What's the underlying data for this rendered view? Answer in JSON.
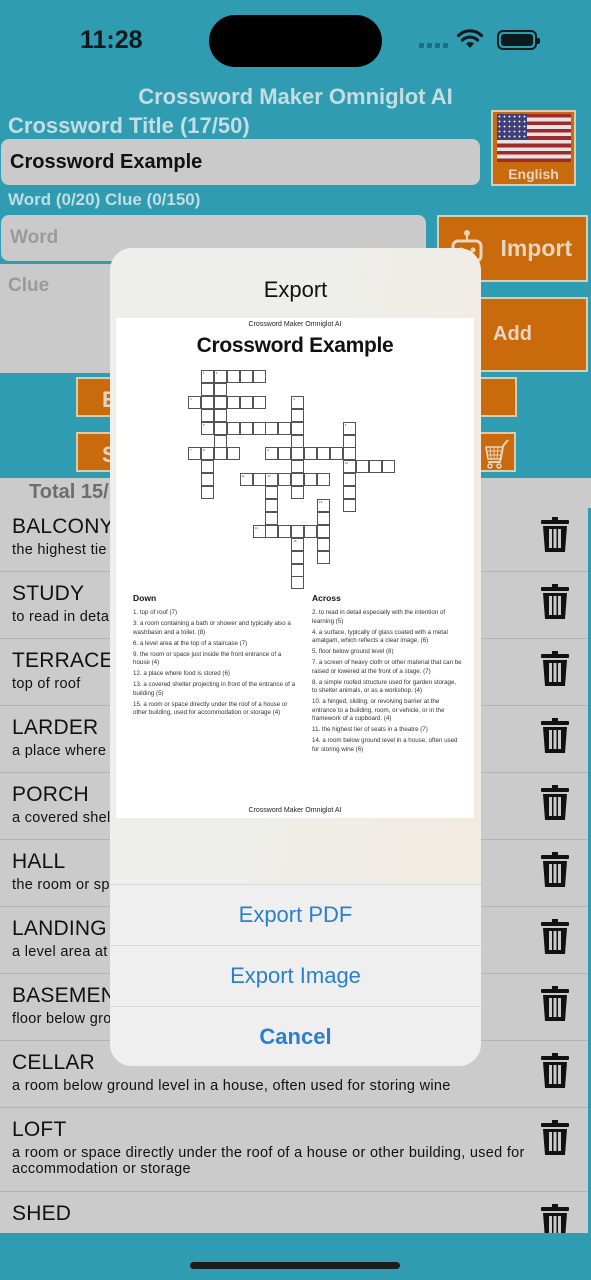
{
  "status_bar": {
    "time": "11:28"
  },
  "header": {
    "app_title": "Crossword Maker Omniglot AI",
    "title_label": "Crossword Title (17/50)",
    "title_value": "Crossword Example",
    "language_label": "English",
    "word_clue_label": "Word (0/20) Clue (0/150)",
    "word_placeholder": "Word",
    "clue_placeholder": "Clue",
    "import_label": "Import",
    "add_label": "Add",
    "export_btn_partial": "E",
    "share_btn_partial": "S",
    "total_label": "Total 15/"
  },
  "words": [
    {
      "word": "BALCONY",
      "clue": "the highest tie"
    },
    {
      "word": "STUDY",
      "clue": "to read in deta"
    },
    {
      "word": "TERRACE",
      "clue": "top of roof"
    },
    {
      "word": "LARDER",
      "clue": "a place where"
    },
    {
      "word": "PORCH",
      "clue": "a covered shel"
    },
    {
      "word": "HALL",
      "clue": "the room or sp"
    },
    {
      "word": "LANDING",
      "clue": "a level area at"
    },
    {
      "word": "BASEMEN",
      "clue": "floor below gro"
    },
    {
      "word": "CELLAR",
      "clue": "a room below ground level in a house, often used for storing wine"
    },
    {
      "word": "LOFT",
      "clue": "a room or space directly under the roof of a house or other building, used for accommodation or storage"
    },
    {
      "word": "SHED",
      "clue": ""
    }
  ],
  "dialog": {
    "title": "Export",
    "preview": {
      "app_name": "Crossword Maker Omniglot AI",
      "title": "Crossword Example",
      "down_heading": "Down",
      "across_heading": "Across",
      "down": [
        "1. top of roof (7)",
        "3. a room containing a bath or shower and typically also a washbasin and a toilet. (8)",
        "6. a level area at the top of a staircase (7)",
        "9. the room or space just inside the front entrance of a house (4)",
        "12. a place where food is stored (6)",
        "13. a covered shelter projecting in front of the entrance of a building (5)",
        "15. a room or space directly under the roof of a house or other building, used for accommodation or storage (4)"
      ],
      "across": [
        "2. to read in detail especially with the intention of learning (5)",
        "4. a surface, typically of glass coated with a metal amalgam, which reflects a clear image. (6)",
        "5. floor below ground level (8)",
        "7. a screen of heavy cloth or other material that can be raised or lowered at the front of a stage. (7)",
        "8. a simple roofed structure used for garden storage, to shelter animals, or as a workshop. (4)",
        "10. a hinged, sliding, or revolving barrier at the entrance to a building, room, or vehicle, or in the framework of a cupboard. (4)",
        "11. the highest tier of seats in a theatre (7)",
        "14. a room below ground level in a house, often used for storing wine (6)"
      ],
      "footer": "Crossword Maker Omniglot AI"
    },
    "actions": [
      "Export PDF",
      "Export Image",
      "Cancel"
    ]
  }
}
